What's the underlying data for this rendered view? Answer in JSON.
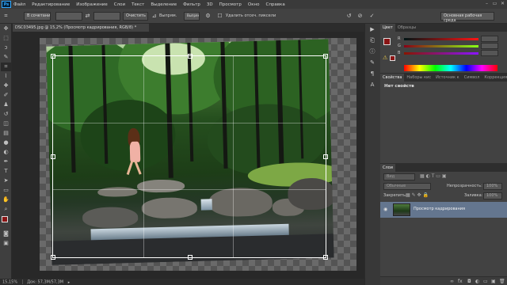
{
  "app": {
    "logo": "Ps"
  },
  "menu": [
    "Файл",
    "Редактирование",
    "Изображение",
    "Слои",
    "Текст",
    "Выделение",
    "Фильтр",
    "3D",
    "Просмотр",
    "Окно",
    "Справка"
  ],
  "window_controls": {
    "minimize": "–",
    "restore": "▭",
    "close": "✕"
  },
  "options": {
    "ratio_select": "В сочетании",
    "clear_button": "Очистить",
    "straighten_label": "Выпрям.",
    "view_select": "Выпрямить",
    "delete_checkbox_label": "Удалить отсеч. пиксели",
    "workspace": "Основная рабочая среда"
  },
  "document": {
    "tab_title": "DSC03495.jpg @ 15,2% (Просмотр кадрирования, RGB/8) *",
    "close": "✕"
  },
  "status": {
    "zoom": "15,15%",
    "doc": "Док: 57,3M/57,3M",
    "arrow": "▸"
  },
  "tools": [
    {
      "name": "move-tool",
      "glyph": "✥"
    },
    {
      "name": "marquee-tool",
      "glyph": "⬚"
    },
    {
      "name": "lasso-tool",
      "glyph": "ↄ"
    },
    {
      "name": "quick-select-tool",
      "glyph": "✎"
    },
    {
      "name": "crop-tool",
      "glyph": "⌗"
    },
    {
      "name": "eyedropper-tool",
      "glyph": "⌇"
    },
    {
      "name": "healing-tool",
      "glyph": "✚"
    },
    {
      "name": "brush-tool",
      "glyph": "✐"
    },
    {
      "name": "clone-stamp-tool",
      "glyph": "♟"
    },
    {
      "name": "history-brush-tool",
      "glyph": "↺"
    },
    {
      "name": "eraser-tool",
      "glyph": "◫"
    },
    {
      "name": "gradient-tool",
      "glyph": "▤"
    },
    {
      "name": "blur-tool",
      "glyph": "●"
    },
    {
      "name": "dodge-tool",
      "glyph": "◐"
    },
    {
      "name": "pen-tool",
      "glyph": "✒"
    },
    {
      "name": "type-tool",
      "glyph": "T"
    },
    {
      "name": "path-select-tool",
      "glyph": "➤"
    },
    {
      "name": "shape-tool",
      "glyph": "▭"
    },
    {
      "name": "hand-tool",
      "glyph": "✋"
    },
    {
      "name": "zoom-tool",
      "glyph": "⌕"
    }
  ],
  "color_panel": {
    "tabs": [
      "Цвет",
      "Образцы"
    ],
    "channels": [
      {
        "label": "R",
        "gradient": "linear-gradient(90deg,#001515,#ff1515)"
      },
      {
        "label": "G",
        "gradient": "linear-gradient(90deg,#8a0015,#8aff15)"
      },
      {
        "label": "B",
        "gradient": "linear-gradient(90deg,#8a1500,#8a15ff)"
      }
    ]
  },
  "properties_panel": {
    "tabs": [
      "Свойства",
      "Наборы кис",
      "Источник к",
      "Символ",
      "Коррекция"
    ],
    "empty_text": "Нет свойств"
  },
  "layers_panel": {
    "tab": "Слои",
    "filter_select": "Вид",
    "blend_mode": "Обычные",
    "opacity_label": "Непрозрачность:",
    "opacity_value": "100%",
    "lock_label": "Закрепить:",
    "fill_label": "Заливка:",
    "fill_value": "100%",
    "layer_name": "Просмотр кадрирования",
    "eye": "◉"
  },
  "colors": {
    "foreground": "#8a1515",
    "selection": "#64768f"
  }
}
